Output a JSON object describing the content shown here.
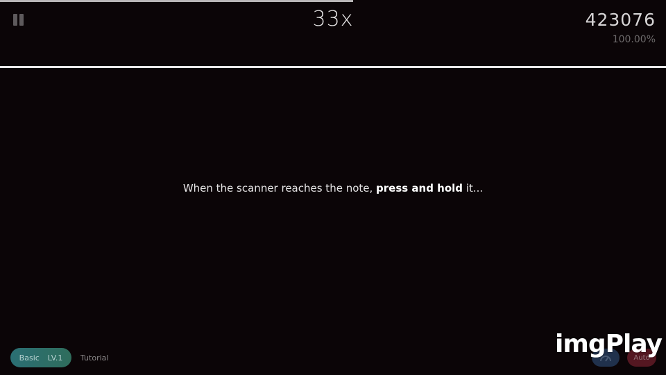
{
  "hud": {
    "progress_fraction": 0.53,
    "combo": "33x",
    "score": "423076",
    "accuracy": "100.00%"
  },
  "instruction": {
    "before": "When the scanner reaches the note, ",
    "bold": "press and hold",
    "after": " it..."
  },
  "footer": {
    "difficulty": "Basic",
    "level": "LV.1",
    "level_name": "Tutorial",
    "auto_label": "Auto"
  },
  "watermark": "imgPlay",
  "colors": {
    "background": "#0b0507",
    "scanner": "#e9e7e8",
    "difficulty_pill": "#2b6f74",
    "auto_button": "#6d1d2a",
    "speed_button": "#2f4f7a"
  },
  "icons": {
    "pause": "pause-icon",
    "speed": "speedometer-icon"
  }
}
